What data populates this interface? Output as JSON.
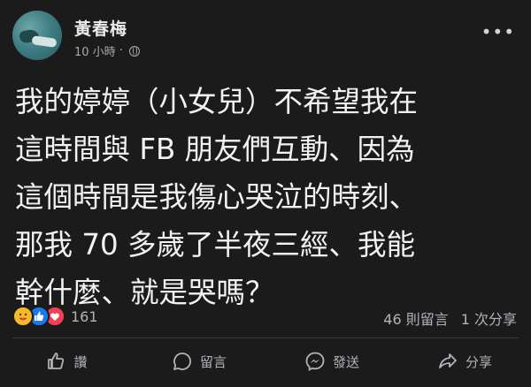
{
  "post": {
    "author": "黃春梅",
    "time": "10 小時",
    "separator": "·",
    "visibility_icon": "globe-icon",
    "more_icon": "more-icon",
    "lines": [
      "我的婷婷（小女兒）不希望我在",
      "這時間與 FB 朋友們互動、因為",
      "這個時間是我傷心哭泣的時刻、",
      "那我 70 多歲了半夜三經、我能",
      "幹什麼、就是哭嗎？"
    ]
  },
  "reactions": {
    "icons": [
      "care-reaction-icon",
      "like-reaction-icon",
      "love-reaction-icon"
    ],
    "count": "161"
  },
  "stats": {
    "comments": "46 則留言",
    "shares": "1 次分享"
  },
  "actions": {
    "like": "讚",
    "comment": "留言",
    "send": "發送",
    "share": "分享"
  },
  "colors": {
    "background": "#1b1b1c",
    "text": "#f1f2f4",
    "secondary": "#b0b3b8",
    "like_blue": "#1877f2",
    "love_red": "#f33e58",
    "care_yellow": "#f7b928"
  }
}
